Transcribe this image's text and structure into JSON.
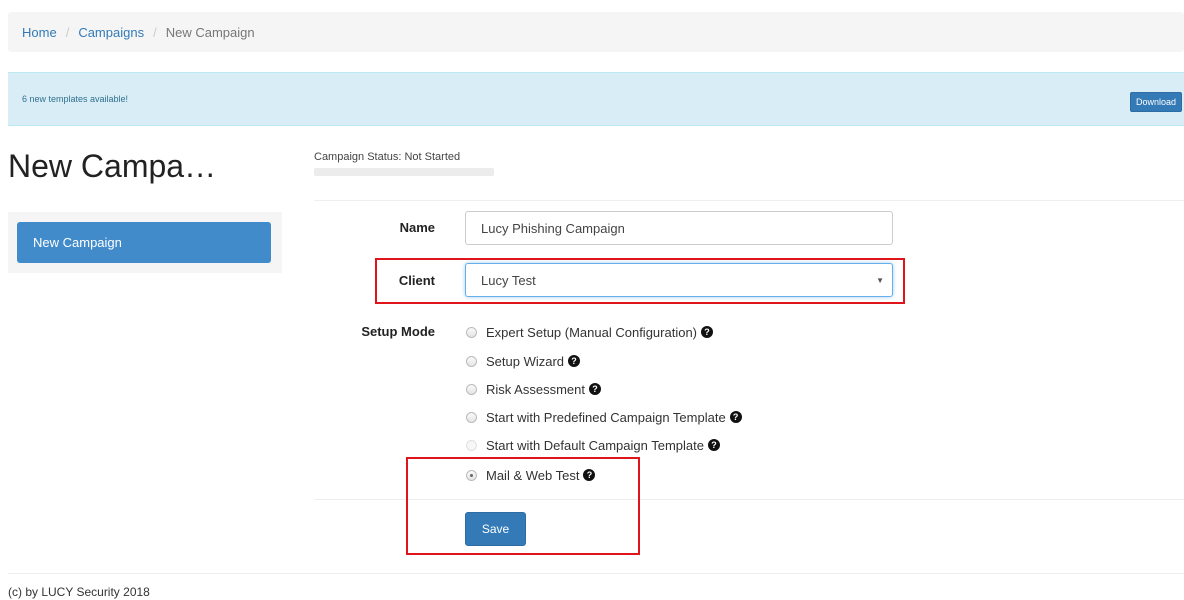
{
  "breadcrumb": {
    "home": "Home",
    "separator": "/",
    "campaigns": "Campaigns",
    "current": "New Campaign"
  },
  "alert": {
    "message": "6 new templates available!",
    "button_label": "Download"
  },
  "page_title": "New Campa…",
  "status": {
    "text": "Campaign Status:  Not Started",
    "progress": 0
  },
  "sidebar": {
    "items": [
      {
        "label": "New Campaign"
      }
    ]
  },
  "form": {
    "name_label": "Name",
    "name_value": "Lucy Phishing Campaign",
    "client_label": "Client",
    "client_value": "Lucy Test",
    "setup_mode_label": "Setup Mode",
    "setup_options": [
      {
        "label": "Expert Setup (Manual Configuration)"
      },
      {
        "label": "Setup Wizard"
      },
      {
        "label": "Risk Assessment"
      },
      {
        "label": "Start with Predefined Campaign Template"
      },
      {
        "label": "Start with Default Campaign Template"
      },
      {
        "label": "Mail & Web Test"
      }
    ],
    "selected_option": "Mail & Web Test",
    "help_icon_glyph": "?",
    "save_label": "Save"
  },
  "footer": "(c) by LUCY Security 2018",
  "colors": {
    "primary": "#337ab7",
    "alert_bg": "#d9edf7",
    "highlight": "#e0141b"
  }
}
